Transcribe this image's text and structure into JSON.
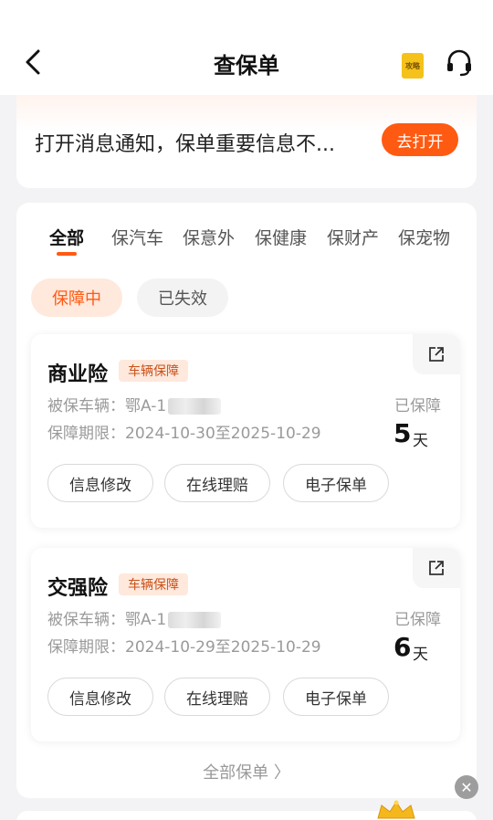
{
  "header": {
    "title": "查保单",
    "guide_label": "攻略"
  },
  "notice": {
    "text": "打开消息通知，保单重要信息不...",
    "button_label": "去打开"
  },
  "tabs": [
    {
      "label": "全部",
      "active": true
    },
    {
      "label": "保汽车",
      "active": false
    },
    {
      "label": "保意外",
      "active": false
    },
    {
      "label": "保健康",
      "active": false
    },
    {
      "label": "保财产",
      "active": false
    },
    {
      "label": "保宠物",
      "active": false
    }
  ],
  "filters": {
    "active": "保障中",
    "inactive": "已失效"
  },
  "policies": [
    {
      "name": "商业险",
      "tag": "车辆保障",
      "vehicle_label": "被保车辆：",
      "vehicle_plate": "鄂A-1",
      "period_label": "保障期限：",
      "period": "2024-10-30至2025-10-29",
      "status": "已保障",
      "days": "5",
      "days_unit": "天",
      "actions": [
        "信息修改",
        "在线理赔",
        "电子保单"
      ]
    },
    {
      "name": "交强险",
      "tag": "车辆保障",
      "vehicle_label": "被保车辆：",
      "vehicle_plate": "鄂A-1",
      "period_label": "保障期限：",
      "period": "2024-10-29至2025-10-29",
      "status": "已保障",
      "days": "6",
      "days_unit": "天",
      "actions": [
        "信息修改",
        "在线理赔",
        "电子保单"
      ]
    }
  ],
  "footer": {
    "all_policies": "全部保单 〉"
  },
  "colors": {
    "accent": "#ff5a12",
    "tag_bg": "#ffe8dc"
  },
  "icons": [
    "back-icon",
    "guide-book-icon",
    "headset-icon",
    "external-link-icon",
    "close-icon",
    "crown-icon"
  ]
}
